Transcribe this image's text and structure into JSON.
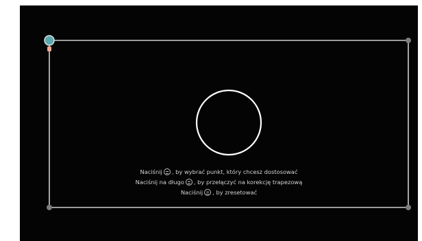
{
  "keystone": {
    "instructions": {
      "line1_before": "Naciśnij",
      "line1_after": ", by wybrać punkt, który chcesz dostosować",
      "line2_before": "Naciśnij na długo",
      "line2_after": ", by przełączyć na korekcję trapezową",
      "line3_before": "Naciśnij",
      "line3_after": ", by zresetować"
    },
    "icons": {
      "ok_button": "ok-button-icon",
      "back_button": "back-button-icon",
      "selected_corner": "selected-corner-handle",
      "direction_hint": "down-arrow-icon"
    },
    "colors": {
      "background": "#040404",
      "frame": "#cfcfcf",
      "corner": "#7d7d7d",
      "selected_corner": "#5aa7ad",
      "text": "#d4d4d4"
    }
  }
}
